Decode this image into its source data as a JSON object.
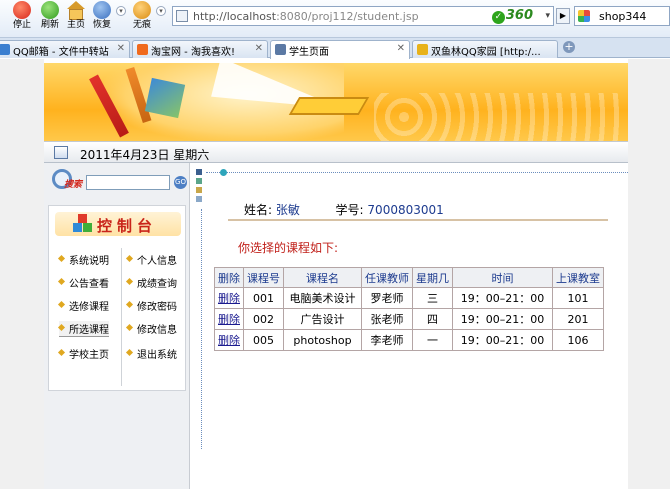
{
  "browser": {
    "toolbar": {
      "stop": "停止",
      "refresh": "刷新",
      "home": "主页",
      "restore": "恢复",
      "trace": "无痕"
    },
    "address": {
      "url_host": "http://localhost",
      "url_rest": ":8080/proj112/student.jsp",
      "brand": "360"
    },
    "search": {
      "value": "shop344"
    },
    "tabs": [
      {
        "label": "QQ邮箱 - 文件中转站",
        "icon_color": "#3b7fd0"
      },
      {
        "label": "淘宝网 - 淘我喜欢!",
        "icon_color": "#f06a1d"
      },
      {
        "label": "学生页面",
        "icon_color": "#5b79a4"
      },
      {
        "label": "双鱼林QQ家园 [http:/...",
        "icon_color": "#e8b21a"
      }
    ],
    "new_tab": "+"
  },
  "page": {
    "date": "2011年4月23日  星期六",
    "sidebar": {
      "search_label": "搜索",
      "search_placeholder": "",
      "go": "GO",
      "panel_title": "控制台",
      "menu_left": [
        "系统说明",
        "公告查看",
        "选修课程",
        "所选课程",
        "学校主页"
      ],
      "menu_right": [
        "个人信息",
        "成绩查询",
        "修改密码",
        "修改信息",
        "退出系统"
      ]
    },
    "student": {
      "name_label": "姓名:",
      "name": "张敏",
      "id_label": "学号:",
      "id": "7000803001"
    },
    "course_heading": "你选择的课程如下:",
    "table": {
      "headers": [
        "删除",
        "课程号",
        "课程名",
        "任课教师",
        "星期几",
        "时间",
        "上课教室"
      ],
      "rows": [
        [
          "删除",
          "001",
          "电脑美术设计",
          "罗老师",
          "三",
          "19：00–21：00",
          "101"
        ],
        [
          "删除",
          "002",
          "广告设计",
          "张老师",
          "四",
          "19：00–21：00",
          "201"
        ],
        [
          "删除",
          "005",
          "photoshop",
          "李老师",
          "一",
          "19：00–21：00",
          "106"
        ]
      ]
    },
    "colors": {
      "accent_red": "#c0201a",
      "link_blue": "#1d3b8f",
      "banner_orange": "#ffb21e"
    }
  }
}
